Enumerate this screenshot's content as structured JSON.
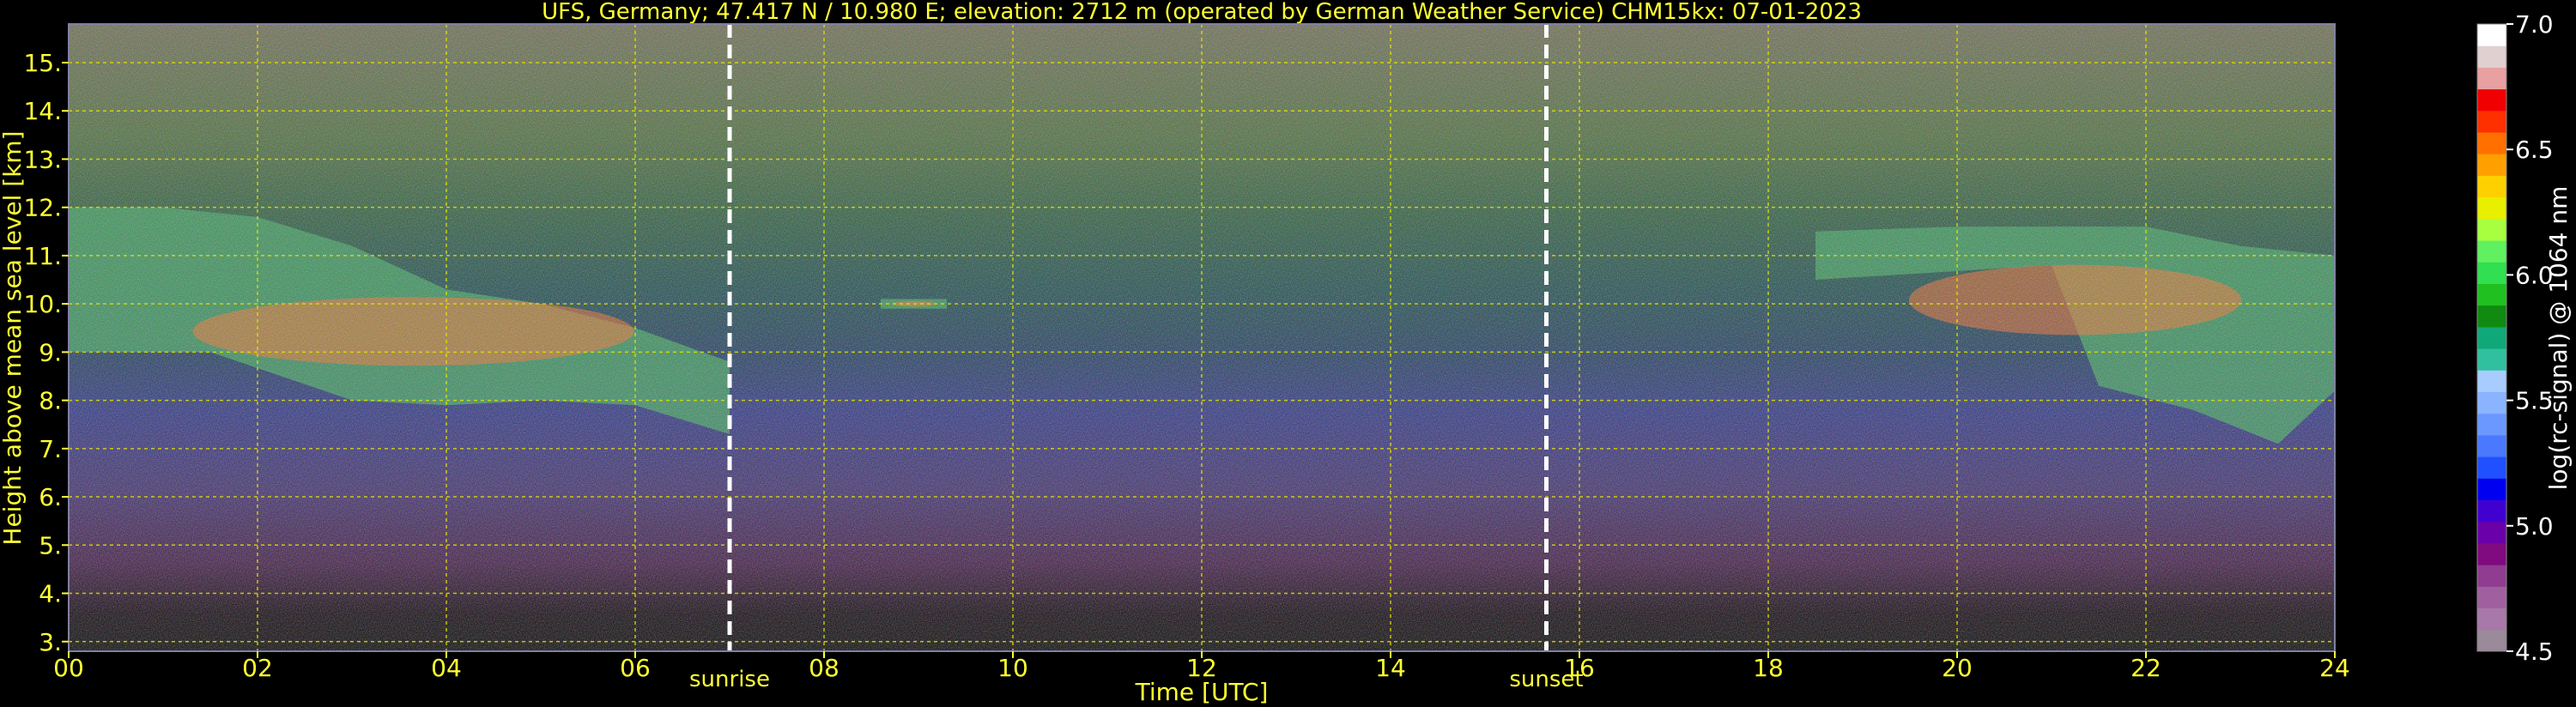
{
  "chart_data": {
    "type": "heatmap",
    "title": "UFS, Germany; 47.417 N / 10.980 E; elevation: 2712 m  (operated by German Weather Service)    CHM15kx: 07-01-2023",
    "xlabel": "Time [UTC]",
    "ylabel": "Height above mean sea level [km]",
    "xlim": [
      0,
      24
    ],
    "ylim": [
      2.8,
      15.8
    ],
    "x_ticks": [
      0,
      2,
      4,
      6,
      8,
      10,
      12,
      14,
      16,
      18,
      20,
      22,
      24
    ],
    "x_tick_labels": [
      "00",
      "02",
      "04",
      "06",
      "08",
      "10",
      "12",
      "14",
      "16",
      "18",
      "20",
      "22",
      "24"
    ],
    "y_ticks": [
      3,
      4,
      5,
      6,
      7,
      8,
      9,
      10,
      11,
      12,
      13,
      14,
      15
    ],
    "y_tick_labels": [
      "3.",
      "4.",
      "5.",
      "6.",
      "7.",
      "8.",
      "9.",
      "10.",
      "11.",
      "12.",
      "13.",
      "14.",
      "15."
    ],
    "grid": true,
    "annotations": [
      {
        "label": "sunrise",
        "x": 7.0
      },
      {
        "label": "sunset",
        "x": 15.65
      }
    ],
    "colorbar": {
      "label": "log(rc-signal) @ 1064 nm",
      "range": [
        4.5,
        7.0
      ],
      "ticks": [
        4.5,
        5.0,
        5.5,
        6.0,
        6.5,
        7.0
      ],
      "tick_labels": [
        "4.5",
        "5.0",
        "5.5",
        "6.0",
        "6.5",
        "7.0"
      ],
      "colors": [
        "#9a8a9a",
        "#a878a8",
        "#a060a0",
        "#903c90",
        "#800a80",
        "#6a00a8",
        "#4000d0",
        "#0000f0",
        "#2050ff",
        "#4a78ff",
        "#6a98ff",
        "#8ab4ff",
        "#a8ccff",
        "#30c0a0",
        "#10a878",
        "#108a10",
        "#20c020",
        "#30e050",
        "#60f060",
        "#a8ff40",
        "#e8f000",
        "#ffd000",
        "#ffa000",
        "#ff7000",
        "#ff3000",
        "#f00000",
        "#e8a0a0",
        "#e0d0d0",
        "#ffffff"
      ]
    },
    "cloud_layers": [
      {
        "x_start": 0.0,
        "x_end": 7.3,
        "y_bottom": [
          [
            0,
            9.0
          ],
          [
            1.5,
            9.0
          ],
          [
            3,
            8.0
          ],
          [
            4,
            7.9
          ],
          [
            5,
            8.0
          ],
          [
            6,
            7.9
          ],
          [
            7,
            7.3
          ]
        ],
        "y_top": [
          [
            0,
            12.0
          ],
          [
            1,
            12.0
          ],
          [
            2,
            11.8
          ],
          [
            3,
            11.2
          ],
          [
            4,
            10.3
          ],
          [
            5,
            10.0
          ],
          [
            6,
            9.5
          ],
          [
            7,
            8.8
          ]
        ]
      },
      {
        "x_start": 18.5,
        "x_end": 24.0,
        "y_bottom": [
          [
            18.5,
            10.5
          ],
          [
            21,
            10.8
          ],
          [
            21.5,
            8.3
          ],
          [
            22.5,
            7.8
          ],
          [
            23.4,
            7.1
          ],
          [
            24,
            8.2
          ]
        ],
        "y_top": [
          [
            18.5,
            11.5
          ],
          [
            20,
            11.6
          ],
          [
            22,
            11.6
          ],
          [
            23,
            11.2
          ],
          [
            24,
            11.0
          ]
        ]
      },
      {
        "x_start": 8.6,
        "x_end": 9.3,
        "y_bottom": [
          [
            8.6,
            9.9
          ],
          [
            9.3,
            9.9
          ]
        ],
        "y_top": [
          [
            8.6,
            10.1
          ],
          [
            9.3,
            10.1
          ]
        ]
      }
    ]
  }
}
